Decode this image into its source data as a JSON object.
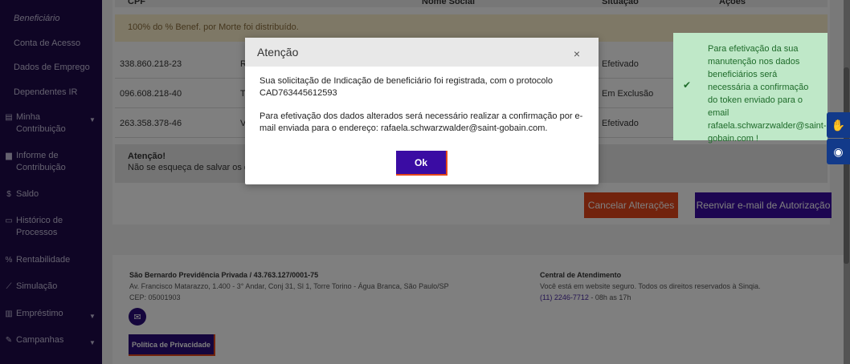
{
  "sidebar": {
    "items": [
      {
        "label": "Beneficiário",
        "icon": "",
        "sub": true,
        "active": true
      },
      {
        "label": "Conta de Acesso",
        "icon": "",
        "sub": true
      },
      {
        "label": "Dados de Emprego",
        "icon": "",
        "sub": true
      },
      {
        "label": "Dependentes IR",
        "icon": "",
        "sub": true
      },
      {
        "label": "Minha Contribuição",
        "icon": "list-icon",
        "caret": true
      },
      {
        "label": "Informe de Contribuição",
        "icon": "document-icon"
      },
      {
        "label": "Saldo",
        "icon": "dollar-icon"
      },
      {
        "label": "Histórico de Processos",
        "icon": "file-icon"
      },
      {
        "label": "Rentabilidade",
        "icon": "percent-icon"
      },
      {
        "label": "Simulação",
        "icon": "chart-icon"
      },
      {
        "label": "Empréstimo",
        "icon": "bank-icon",
        "caret": true
      },
      {
        "label": "Campanhas",
        "icon": "edit-icon",
        "caret": true
      }
    ]
  },
  "table": {
    "headers": {
      "cpf": "CPF",
      "nome_social": "Nome Social",
      "situacao": "Situação",
      "acoes": "Ações"
    },
    "warning": "100% do % Benef. por Morte foi distribuído.",
    "rows": [
      {
        "cpf": "338.860.218-23",
        "nome": "R",
        "situacao": "Efetivado"
      },
      {
        "cpf": "096.608.218-40",
        "nome": "T",
        "situacao": "Em Exclusão"
      },
      {
        "cpf": "263.358.378-46",
        "nome": "V",
        "situacao": "Efetivado"
      }
    ],
    "note_title": "Atenção!",
    "note_text": "Não se esqueça de salvar os d"
  },
  "actions": {
    "cancel_label": "Cancelar Alterações",
    "resend_label": "Reenviar e-mail de Autorização"
  },
  "footer": {
    "company": "São Bernardo Previdência Privada / 43.763.127/0001-75",
    "address": "Av. Francisco Matarazzo, 1.400 - 3° Andar, Conj 31, Sl 1, Torre Torino - Água Branca, São Paulo/SP",
    "cep": "CEP: 05001903",
    "privacy_label": "Política de Privacidade",
    "support_title": "Central de Atendimento",
    "support_text": "Você está em website seguro. Todos os direitos reservados à Sinqia.",
    "phone": "(11) 2246-7712",
    "hours": " - 08h as 17h"
  },
  "modal": {
    "title": "Atenção",
    "close": "×",
    "message1": "Sua solicitação de Indicação de beneficiário foi registrada, com o protocolo CAD763445612593",
    "message2": "Para efetivação dos dados alterados será necessário realizar a confirmação por e-mail enviada para o endereço: rafaela.schwarzwalder@saint-gobain.com.",
    "ok_label": "Ok"
  },
  "toast": {
    "message": "Para efetivação da sua manutenção nos dados beneficiários será necessária a confirmação do token enviado para o email rafaela.schwarzwalder@saint-gobain.com !",
    "icon": "check-icon"
  },
  "colors": {
    "sidebar": "#1e0a4a",
    "primary": "#3a0ca3",
    "accent": "#e4471a",
    "toast_bg": "#bfe8c8"
  }
}
